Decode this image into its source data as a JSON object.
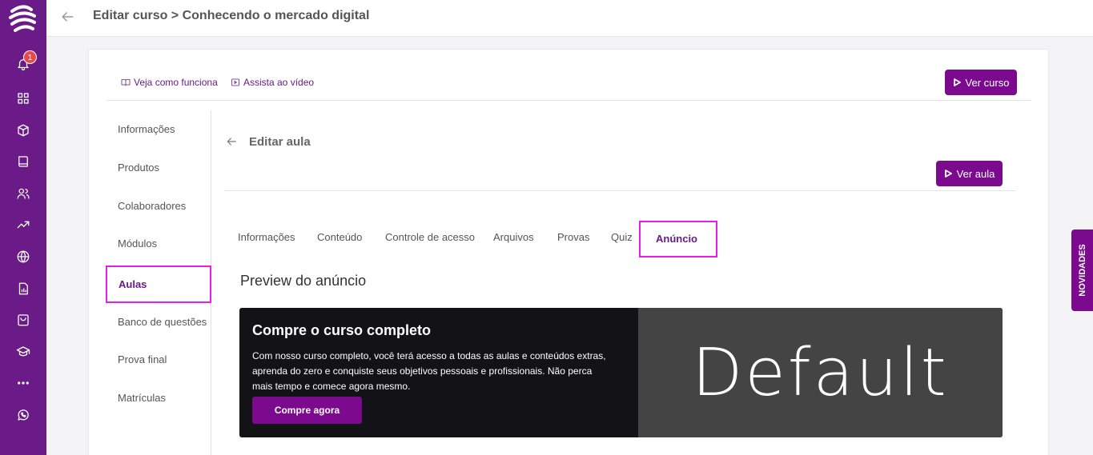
{
  "header": {
    "title": "Editar curso > Conhecendo o mercado digital"
  },
  "sidebar": {
    "notification_count": "1",
    "icons": [
      "bell-icon",
      "dashboard-icon",
      "box-icon",
      "book-icon",
      "users-icon",
      "trending-icon",
      "globe-icon",
      "report-icon",
      "bag-icon",
      "graduation-icon",
      "more-icon",
      "whatsapp-icon"
    ]
  },
  "toplinks": {
    "how_it_works": "Veja como funciona",
    "watch_video": "Assista ao vídeo"
  },
  "buttons": {
    "view_course": "Ver curso",
    "view_lesson": "Ver aula"
  },
  "course_menu": {
    "items": [
      "Informações",
      "Produtos",
      "Colaboradores",
      "Módulos",
      "Aulas",
      "Banco de questões",
      "Prova final",
      "Matrículas"
    ],
    "active": "Aulas"
  },
  "lesson": {
    "title": "Editar aula"
  },
  "tabs": {
    "items": [
      "Informações",
      "Conteúdo",
      "Controle de acesso",
      "Arquivos",
      "Provas",
      "Quiz",
      "Anúncio"
    ],
    "active": "Anúncio"
  },
  "preview": {
    "title": "Preview do anúncio",
    "ad_title": "Compre o curso completo",
    "ad_description": "Com nosso curso completo, você terá acesso a todas as aulas e conteúdos extras, aprenda do zero e conquiste seus objetivos pessoais e profissionais. Não perca mais tempo e comece agora mesmo.",
    "ad_button": "Compre agora",
    "ad_image_text": "Default"
  },
  "novidades": "NOVIDADES",
  "colors": {
    "brand": "#6a1b88",
    "button": "#7b0a8f",
    "highlight": "#e61ee6"
  }
}
